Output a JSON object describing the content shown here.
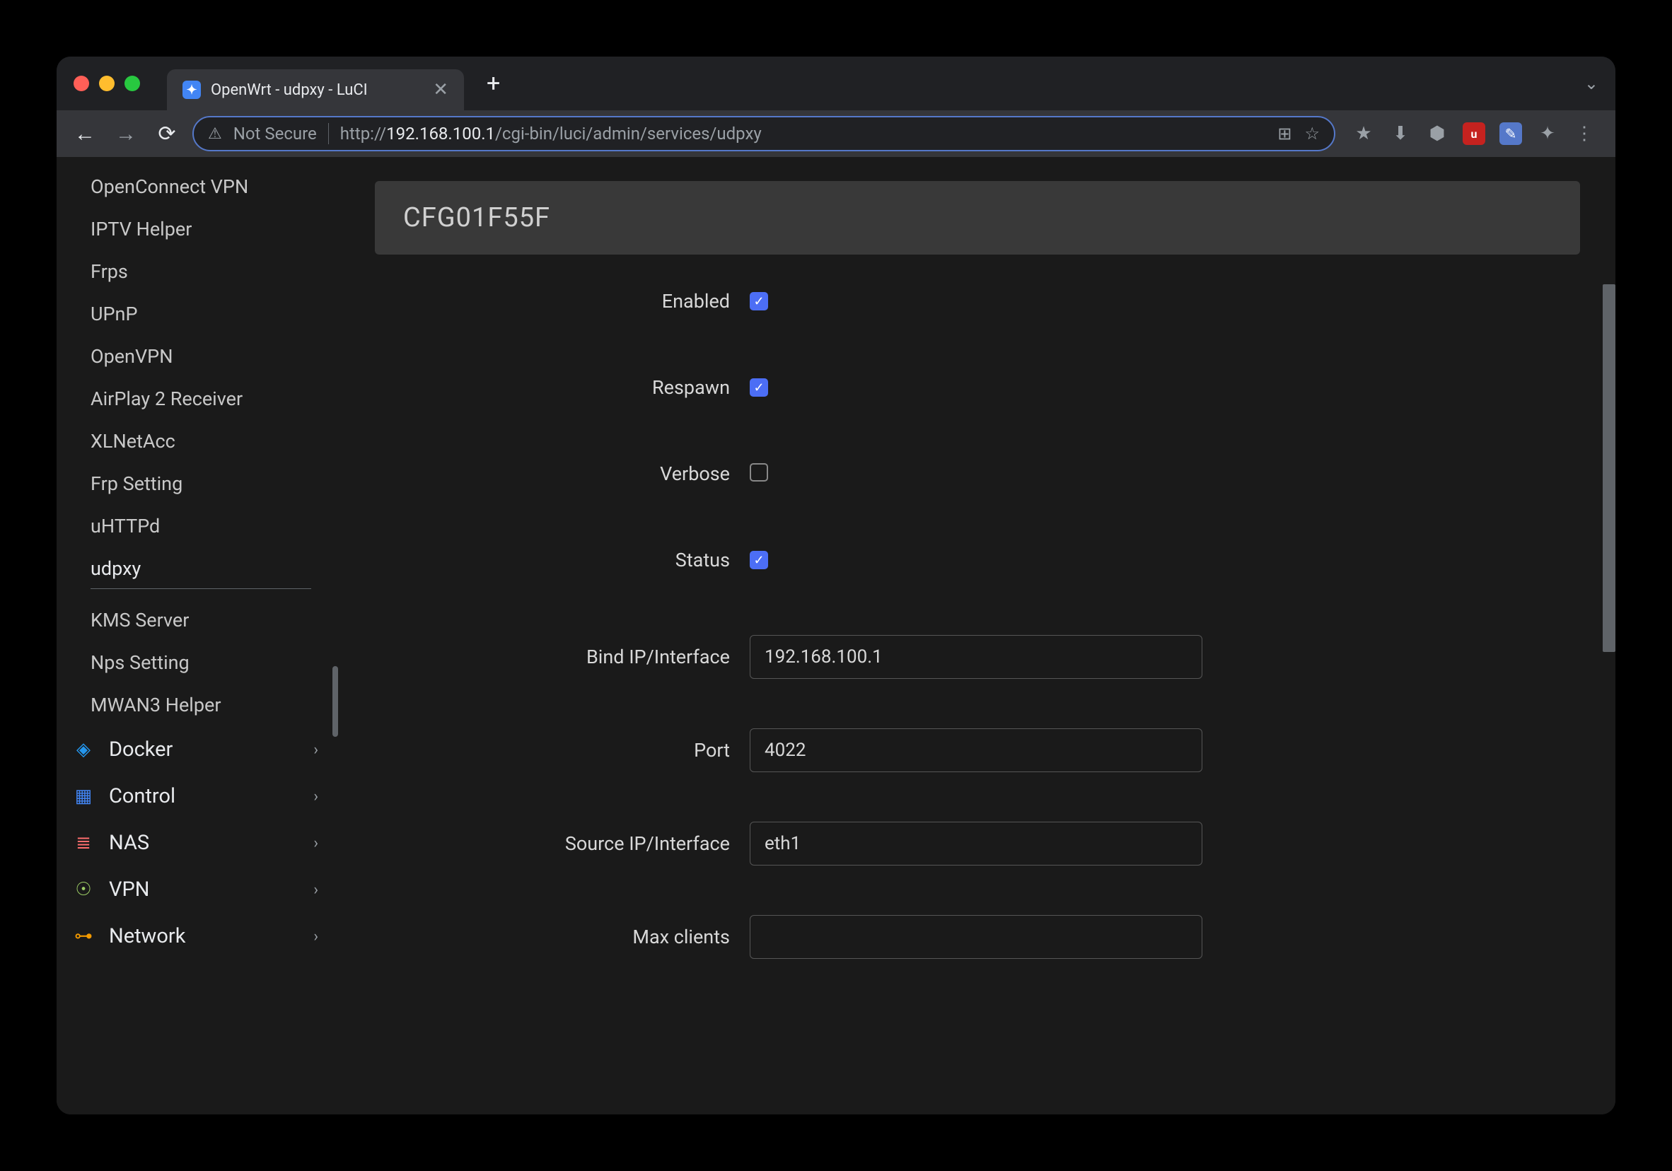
{
  "browser": {
    "tab_title": "OpenWrt - udpxy - LuCI",
    "not_secure": "Not Secure",
    "url_prefix": "http://",
    "url_host": "192.168.100.1",
    "url_path": "/cgi-bin/luci/admin/services/udpxy"
  },
  "sidebar": {
    "items": [
      {
        "label": "OpenConnect VPN",
        "active": false
      },
      {
        "label": "IPTV Helper",
        "active": false
      },
      {
        "label": "Frps",
        "active": false
      },
      {
        "label": "UPnP",
        "active": false
      },
      {
        "label": "OpenVPN",
        "active": false
      },
      {
        "label": "AirPlay 2 Receiver",
        "active": false
      },
      {
        "label": "XLNetAcc",
        "active": false
      },
      {
        "label": "Frp Setting",
        "active": false
      },
      {
        "label": "uHTTPd",
        "active": false
      },
      {
        "label": "udpxy",
        "active": true
      },
      {
        "label": "KMS Server",
        "active": false
      },
      {
        "label": "Nps Setting",
        "active": false
      },
      {
        "label": "MWAN3 Helper",
        "active": false
      }
    ],
    "groups": [
      {
        "label": "Docker",
        "icon": "docker"
      },
      {
        "label": "Control",
        "icon": "control"
      },
      {
        "label": "NAS",
        "icon": "nas"
      },
      {
        "label": "VPN",
        "icon": "vpn"
      },
      {
        "label": "Network",
        "icon": "net"
      }
    ]
  },
  "panel": {
    "title": "CFG01F55F",
    "fields": {
      "enabled": {
        "label": "Enabled",
        "checked": true
      },
      "respawn": {
        "label": "Respawn",
        "checked": true
      },
      "verbose": {
        "label": "Verbose",
        "checked": false
      },
      "status": {
        "label": "Status",
        "checked": true
      },
      "bind": {
        "label": "Bind IP/Interface",
        "value": "192.168.100.1"
      },
      "port": {
        "label": "Port",
        "value": "4022"
      },
      "source": {
        "label": "Source IP/Interface",
        "value": "eth1"
      },
      "maxclients": {
        "label": "Max clients",
        "value": ""
      }
    }
  }
}
